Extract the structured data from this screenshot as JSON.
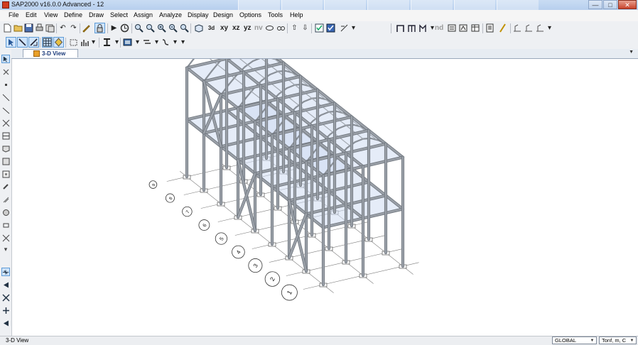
{
  "window": {
    "title": "SAP2000 v16.0.0 Advanced  - 12",
    "minimize_label": "—",
    "maximize_label": "□",
    "close_label": "✕"
  },
  "menu": [
    "File",
    "Edit",
    "View",
    "Define",
    "Draw",
    "Select",
    "Assign",
    "Analyze",
    "Display",
    "Design",
    "Options",
    "Tools",
    "Help"
  ],
  "toolbar": {
    "view_xy": "xy",
    "view_xz": "xz",
    "view_yz": "yz",
    "view_nv": "nv",
    "view_nd": "nd"
  },
  "tab": {
    "label": "3-D View"
  },
  "grid_bubbles": [
    "1",
    "2",
    "3",
    "4",
    "5",
    "6",
    "7",
    "8",
    "9"
  ],
  "status": {
    "view_name": "3-D View",
    "coord_system": "GLOBAL",
    "units": "Tonf, m, C"
  },
  "colors": {
    "steel_member": "#9aa0a8",
    "slab": "#cfdcf3",
    "grid_line": "#7a7a7a",
    "canvas": "#ffffff"
  }
}
